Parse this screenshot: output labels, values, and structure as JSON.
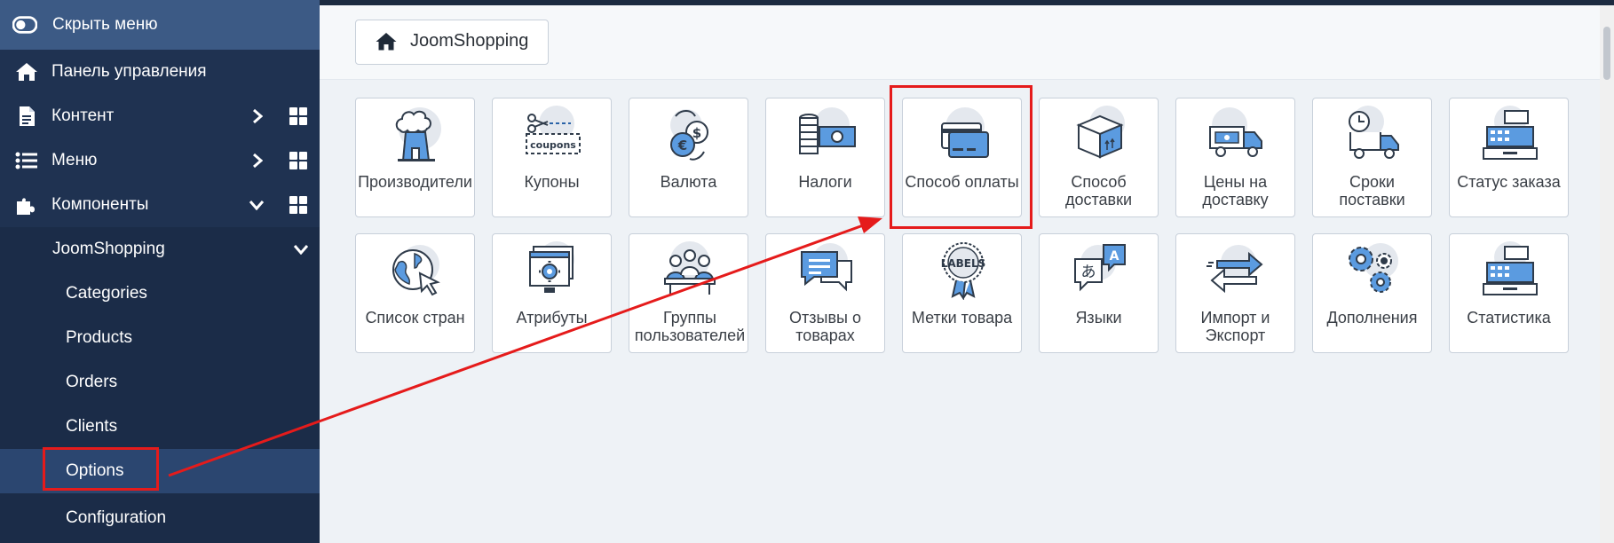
{
  "sidebar": {
    "toggle_label": "Скрыть меню",
    "items": [
      {
        "label": "Панель управления"
      },
      {
        "label": "Контент"
      },
      {
        "label": "Меню"
      },
      {
        "label": "Компоненты"
      },
      {
        "label": "JoomShopping"
      },
      {
        "label": "Categories"
      },
      {
        "label": "Products"
      },
      {
        "label": "Orders"
      },
      {
        "label": "Clients"
      },
      {
        "label": "Options"
      },
      {
        "label": "Configuration"
      }
    ]
  },
  "breadcrumb": {
    "label": "JoomShopping"
  },
  "tiles": [
    {
      "label": "Производители",
      "icon": "manufacturer-icon"
    },
    {
      "label": "Купоны",
      "icon": "coupons-icon",
      "icon_text": "coupons"
    },
    {
      "label": "Валюта",
      "icon": "currency-icon"
    },
    {
      "label": "Налоги",
      "icon": "taxes-icon"
    },
    {
      "label": "Способ оплаты",
      "icon": "payment-card-icon"
    },
    {
      "label": "Способ доставки",
      "icon": "shipping-box-icon"
    },
    {
      "label": "Цены на доставку",
      "icon": "shipping-price-truck-icon"
    },
    {
      "label": "Сроки поставки",
      "icon": "delivery-time-truck-icon"
    },
    {
      "label": "Статус заказа",
      "icon": "cash-register-icon"
    },
    {
      "label": "Список стран",
      "icon": "globe-cursor-icon"
    },
    {
      "label": "Атрибуты",
      "icon": "attributes-gear-icon"
    },
    {
      "label": "Группы пользователей",
      "icon": "user-groups-icon"
    },
    {
      "label": "Отзывы о товарах",
      "icon": "reviews-chat-icon"
    },
    {
      "label": "Метки товара",
      "icon": "labels-badge-icon",
      "icon_text": "LABELS"
    },
    {
      "label": "Языки",
      "icon": "languages-icon"
    },
    {
      "label": "Импорт и Экспорт",
      "icon": "import-export-icon"
    },
    {
      "label": "Дополнения",
      "icon": "addons-gears-icon"
    },
    {
      "label": "Статистика",
      "icon": "statistics-register-icon"
    }
  ],
  "colors": {
    "sidebar_bg": "#1f3251",
    "accent": "#2a63a8",
    "annotation": "#e51b1b"
  }
}
